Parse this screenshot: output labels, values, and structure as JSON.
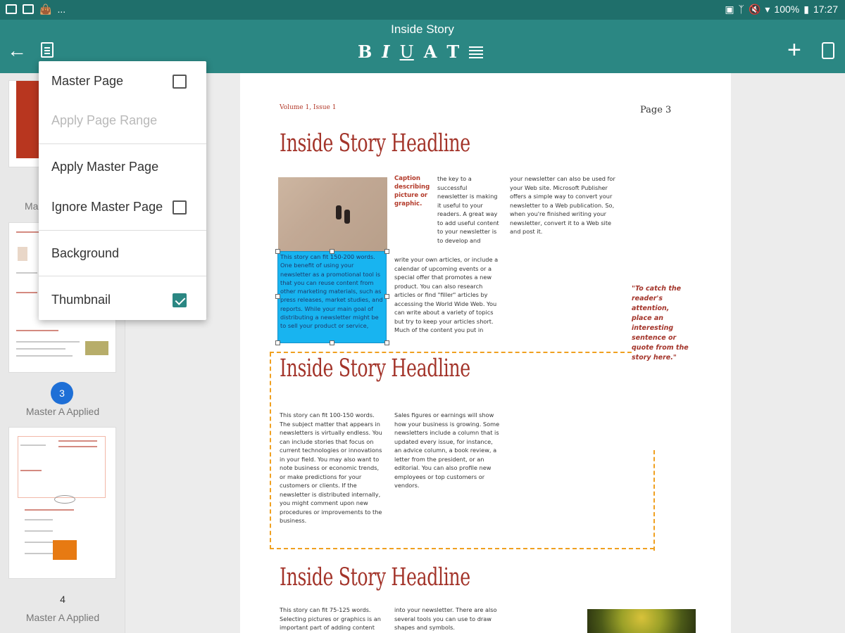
{
  "status_bar": {
    "battery": "100%",
    "time": "17:27",
    "left_icons": [
      "image-icon",
      "mail-icon",
      "bag-icon",
      "more-dots-icon"
    ],
    "more": "..."
  },
  "app_bar": {
    "title": "Inside Story",
    "format_buttons": [
      "B",
      "I",
      "U",
      "A",
      "T"
    ]
  },
  "menu": {
    "items": [
      {
        "label": "Master Page",
        "checkbox": true,
        "checked": false
      },
      {
        "label": "Apply Page Range",
        "disabled": true
      },
      {
        "label": "Apply Master Page"
      },
      {
        "label": "Ignore Master Page",
        "checkbox": true,
        "checked": false
      },
      {
        "label": "Background"
      },
      {
        "label": "Thumbnail",
        "checkbox": true,
        "checked": true
      }
    ]
  },
  "sidebar": {
    "page2_label_partial": "Ma",
    "page3_number": "3",
    "page3_label": "Master A Applied",
    "page4_number": "4",
    "page4_label": "Master A Applied"
  },
  "document": {
    "volume": "Volume 1, Issue 1",
    "page_label": "Page 3",
    "headline1": "Inside Story Headline",
    "caption": "Caption describing picture or graphic.",
    "col2_top": "the key to a successful newsletter is making it useful to your readers. A great way to add useful content to your newsletter is to develop and",
    "col3_top": "your newsletter can also be used for your Web site. Microsoft Publisher offers a simple way to convert your newsletter to a Web publication. So, when you're finished writing your newsletter, convert it to a Web site and post it.",
    "selected_text": "This story can fit 150-200 words. One benefit of using your newsletter as a promotional tool is that you can reuse content from other marketing materials, such as press releases, market studies, and reports. While your main goal of distributing a newsletter might be to sell your product or service,",
    "col2_mid": "write your own articles, or include a calendar of upcoming events or a special offer that promotes a new product. You can also research articles or find \"filler\" articles by accessing the World Wide Web. You can write about a variety of topics but try to keep your articles short. Much of the content you put in",
    "pull_quote": "\"To catch the reader's attention, place an interesting sentence or quote from the story here.\"",
    "headline2": "Inside Story Headline",
    "story2_col1": "This story can fit 100-150 words. The subject matter that appears in newsletters is virtually endless. You can include stories that focus on current technologies or innovations in your field. You may also want to note business or economic trends, or make predictions for your customers or clients. If the newsletter is distributed internally, you might comment upon new procedures or improvements to the business.",
    "story2_col2": "Sales figures or earnings will show how your business is growing. Some newsletters include a column that is updated every issue, for instance, an advice column, a book review, a letter from the president, or an editorial. You can also profile new employees or top customers or vendors.",
    "headline3": "Inside Story Headline",
    "story3_col1": "This story can fit 75-125 words. Selecting pictures or graphics is an important part of adding content",
    "story3_col2": "into your newsletter. There are also several tools you can use to draw shapes and symbols."
  },
  "colors": {
    "status_bar": "#1f6f6b",
    "app_bar": "#2b8783",
    "headline": "#a3342a",
    "selection": "#18b4f0",
    "frame": "#f0a020",
    "badge": "#1e6fd6"
  }
}
